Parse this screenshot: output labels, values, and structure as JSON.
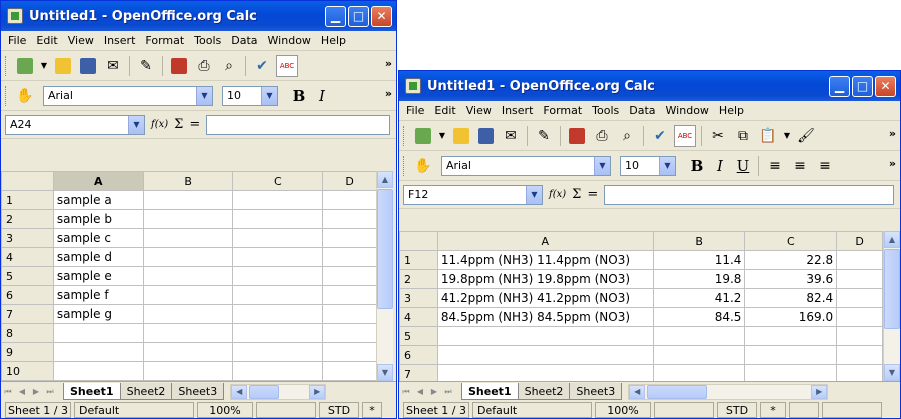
{
  "windows": [
    {
      "title": "Untitled1 - OpenOffice.org Calc",
      "menu": [
        "File",
        "Edit",
        "View",
        "Insert",
        "Format",
        "Tools",
        "Data",
        "Window",
        "Help"
      ],
      "font_name": "Arial",
      "font_size": "10",
      "name_box": "A24",
      "formula_symbols": {
        "wizard": "f(x)",
        "sum": "Σ",
        "equals": "="
      },
      "columns": [
        "A",
        "B",
        "C",
        "D"
      ],
      "rows": [
        {
          "n": "1",
          "cells": [
            "sample a",
            "",
            "",
            ""
          ]
        },
        {
          "n": "2",
          "cells": [
            "sample b",
            "",
            "",
            ""
          ]
        },
        {
          "n": "3",
          "cells": [
            "sample c",
            "",
            "",
            ""
          ]
        },
        {
          "n": "4",
          "cells": [
            "sample d",
            "",
            "",
            ""
          ]
        },
        {
          "n": "5",
          "cells": [
            "sample e",
            "",
            "",
            ""
          ]
        },
        {
          "n": "6",
          "cells": [
            "sample f",
            "",
            "",
            ""
          ]
        },
        {
          "n": "7",
          "cells": [
            "sample g",
            "",
            "",
            ""
          ]
        },
        {
          "n": "8",
          "cells": [
            "",
            "",
            "",
            ""
          ]
        },
        {
          "n": "9",
          "cells": [
            "",
            "",
            "",
            ""
          ]
        },
        {
          "n": "10",
          "cells": [
            "",
            "",
            "",
            ""
          ]
        }
      ],
      "tabs": [
        "Sheet1",
        "Sheet2",
        "Sheet3"
      ],
      "active_tab": "Sheet1",
      "status": {
        "sheet": "Sheet 1 / 3",
        "style": "Default",
        "zoom": "100%",
        "mode": "STD",
        "modified": "*"
      }
    },
    {
      "title": "Untitled1 - OpenOffice.org Calc",
      "menu": [
        "File",
        "Edit",
        "View",
        "Insert",
        "Format",
        "Tools",
        "Data",
        "Window",
        "Help"
      ],
      "font_name": "Arial",
      "font_size": "10",
      "name_box": "F12",
      "formula_symbols": {
        "wizard": "f(x)",
        "sum": "Σ",
        "equals": "="
      },
      "format_buttons": {
        "bold": "B",
        "italic": "I",
        "underline": "U"
      },
      "columns": [
        "A",
        "B",
        "C",
        "D"
      ],
      "rows": [
        {
          "n": "1",
          "cells": [
            "11.4ppm (NH3) 11.4ppm (NO3)",
            "11.4",
            "22.8",
            ""
          ]
        },
        {
          "n": "2",
          "cells": [
            "19.8ppm (NH3) 19.8ppm (NO3)",
            "19.8",
            "39.6",
            ""
          ]
        },
        {
          "n": "3",
          "cells": [
            "41.2ppm (NH3) 41.2ppm (NO3)",
            "41.2",
            "82.4",
            ""
          ]
        },
        {
          "n": "4",
          "cells": [
            "84.5ppm (NH3) 84.5ppm (NO3)",
            "84.5",
            "169.0",
            ""
          ]
        },
        {
          "n": "5",
          "cells": [
            "",
            "",
            "",
            ""
          ]
        },
        {
          "n": "6",
          "cells": [
            "",
            "",
            "",
            ""
          ]
        },
        {
          "n": "7",
          "cells": [
            "",
            "",
            "",
            ""
          ]
        }
      ],
      "tabs": [
        "Sheet1",
        "Sheet2",
        "Sheet3"
      ],
      "active_tab": "Sheet1",
      "status": {
        "sheet": "Sheet 1 / 3",
        "style": "Default",
        "zoom": "100%",
        "mode": "STD",
        "modified": "*"
      }
    }
  ],
  "colors": {
    "titlebar": "#0a5fe6",
    "chrome": "#ece9d8",
    "close_button": "#c8452a"
  }
}
